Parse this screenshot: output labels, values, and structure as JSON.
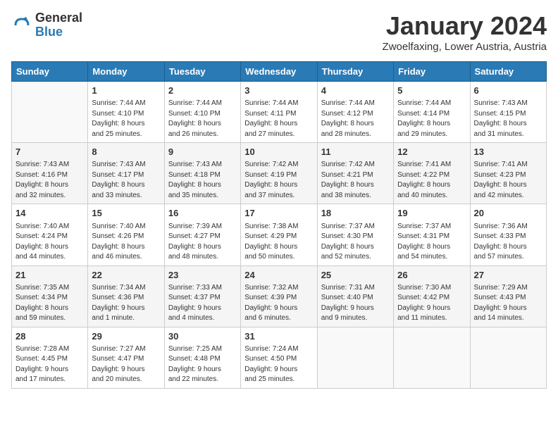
{
  "header": {
    "logo_general": "General",
    "logo_blue": "Blue",
    "month_title": "January 2024",
    "location": "Zwoelfaxing, Lower Austria, Austria"
  },
  "weekdays": [
    "Sunday",
    "Monday",
    "Tuesday",
    "Wednesday",
    "Thursday",
    "Friday",
    "Saturday"
  ],
  "weeks": [
    [
      {
        "day": "",
        "info": ""
      },
      {
        "day": "1",
        "info": "Sunrise: 7:44 AM\nSunset: 4:10 PM\nDaylight: 8 hours\nand 25 minutes."
      },
      {
        "day": "2",
        "info": "Sunrise: 7:44 AM\nSunset: 4:10 PM\nDaylight: 8 hours\nand 26 minutes."
      },
      {
        "day": "3",
        "info": "Sunrise: 7:44 AM\nSunset: 4:11 PM\nDaylight: 8 hours\nand 27 minutes."
      },
      {
        "day": "4",
        "info": "Sunrise: 7:44 AM\nSunset: 4:12 PM\nDaylight: 8 hours\nand 28 minutes."
      },
      {
        "day": "5",
        "info": "Sunrise: 7:44 AM\nSunset: 4:14 PM\nDaylight: 8 hours\nand 29 minutes."
      },
      {
        "day": "6",
        "info": "Sunrise: 7:43 AM\nSunset: 4:15 PM\nDaylight: 8 hours\nand 31 minutes."
      }
    ],
    [
      {
        "day": "7",
        "info": "Sunrise: 7:43 AM\nSunset: 4:16 PM\nDaylight: 8 hours\nand 32 minutes."
      },
      {
        "day": "8",
        "info": "Sunrise: 7:43 AM\nSunset: 4:17 PM\nDaylight: 8 hours\nand 33 minutes."
      },
      {
        "day": "9",
        "info": "Sunrise: 7:43 AM\nSunset: 4:18 PM\nDaylight: 8 hours\nand 35 minutes."
      },
      {
        "day": "10",
        "info": "Sunrise: 7:42 AM\nSunset: 4:19 PM\nDaylight: 8 hours\nand 37 minutes."
      },
      {
        "day": "11",
        "info": "Sunrise: 7:42 AM\nSunset: 4:21 PM\nDaylight: 8 hours\nand 38 minutes."
      },
      {
        "day": "12",
        "info": "Sunrise: 7:41 AM\nSunset: 4:22 PM\nDaylight: 8 hours\nand 40 minutes."
      },
      {
        "day": "13",
        "info": "Sunrise: 7:41 AM\nSunset: 4:23 PM\nDaylight: 8 hours\nand 42 minutes."
      }
    ],
    [
      {
        "day": "14",
        "info": "Sunrise: 7:40 AM\nSunset: 4:24 PM\nDaylight: 8 hours\nand 44 minutes."
      },
      {
        "day": "15",
        "info": "Sunrise: 7:40 AM\nSunset: 4:26 PM\nDaylight: 8 hours\nand 46 minutes."
      },
      {
        "day": "16",
        "info": "Sunrise: 7:39 AM\nSunset: 4:27 PM\nDaylight: 8 hours\nand 48 minutes."
      },
      {
        "day": "17",
        "info": "Sunrise: 7:38 AM\nSunset: 4:29 PM\nDaylight: 8 hours\nand 50 minutes."
      },
      {
        "day": "18",
        "info": "Sunrise: 7:37 AM\nSunset: 4:30 PM\nDaylight: 8 hours\nand 52 minutes."
      },
      {
        "day": "19",
        "info": "Sunrise: 7:37 AM\nSunset: 4:31 PM\nDaylight: 8 hours\nand 54 minutes."
      },
      {
        "day": "20",
        "info": "Sunrise: 7:36 AM\nSunset: 4:33 PM\nDaylight: 8 hours\nand 57 minutes."
      }
    ],
    [
      {
        "day": "21",
        "info": "Sunrise: 7:35 AM\nSunset: 4:34 PM\nDaylight: 8 hours\nand 59 minutes."
      },
      {
        "day": "22",
        "info": "Sunrise: 7:34 AM\nSunset: 4:36 PM\nDaylight: 9 hours\nand 1 minute."
      },
      {
        "day": "23",
        "info": "Sunrise: 7:33 AM\nSunset: 4:37 PM\nDaylight: 9 hours\nand 4 minutes."
      },
      {
        "day": "24",
        "info": "Sunrise: 7:32 AM\nSunset: 4:39 PM\nDaylight: 9 hours\nand 6 minutes."
      },
      {
        "day": "25",
        "info": "Sunrise: 7:31 AM\nSunset: 4:40 PM\nDaylight: 9 hours\nand 9 minutes."
      },
      {
        "day": "26",
        "info": "Sunrise: 7:30 AM\nSunset: 4:42 PM\nDaylight: 9 hours\nand 11 minutes."
      },
      {
        "day": "27",
        "info": "Sunrise: 7:29 AM\nSunset: 4:43 PM\nDaylight: 9 hours\nand 14 minutes."
      }
    ],
    [
      {
        "day": "28",
        "info": "Sunrise: 7:28 AM\nSunset: 4:45 PM\nDaylight: 9 hours\nand 17 minutes."
      },
      {
        "day": "29",
        "info": "Sunrise: 7:27 AM\nSunset: 4:47 PM\nDaylight: 9 hours\nand 20 minutes."
      },
      {
        "day": "30",
        "info": "Sunrise: 7:25 AM\nSunset: 4:48 PM\nDaylight: 9 hours\nand 22 minutes."
      },
      {
        "day": "31",
        "info": "Sunrise: 7:24 AM\nSunset: 4:50 PM\nDaylight: 9 hours\nand 25 minutes."
      },
      {
        "day": "",
        "info": ""
      },
      {
        "day": "",
        "info": ""
      },
      {
        "day": "",
        "info": ""
      }
    ]
  ]
}
